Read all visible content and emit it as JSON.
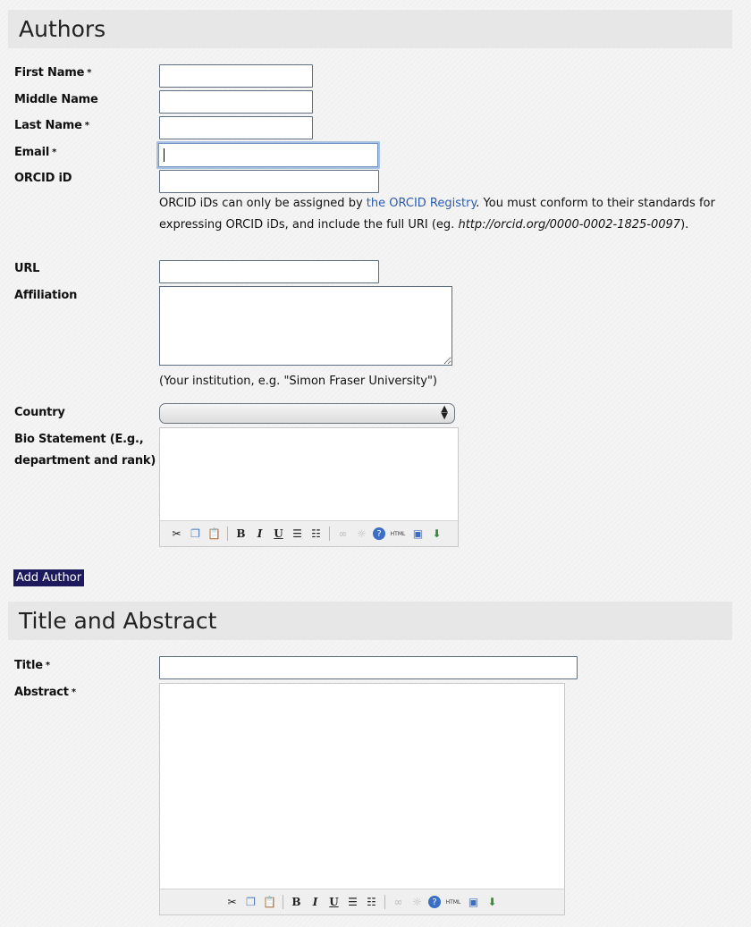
{
  "authors_section": {
    "title": "Authors",
    "first_name_label": "First Name",
    "middle_name_label": "Middle Name",
    "last_name_label": "Last Name",
    "email_label": "Email",
    "orcid_label": "ORCID iD",
    "orcid_note_1": "ORCID iDs can only be assigned by ",
    "orcid_link": "the ORCID Registry",
    "orcid_note_2": ". You must conform to their standards for expressing ORCID iDs, and include the full URI (eg. ",
    "orcid_example": "http://orcid.org/0000-0002-1825-0097",
    "orcid_note_3": ").",
    "url_label": "URL",
    "affiliation_label": "Affiliation",
    "affiliation_hint": "(Your institution, e.g. \"Simon Fraser University\")",
    "country_label": "Country",
    "country_value": "",
    "bio_label": "Bio Statement (E.g., department and rank)",
    "add_author_button": "Add Author",
    "required_mark": "*"
  },
  "title_section": {
    "title": "Title and Abstract",
    "title_label": "Title",
    "abstract_label": "Abstract"
  },
  "toolbar_icons": [
    "cut-icon",
    "copy-icon",
    "paste-icon",
    "bold-icon",
    "italic-icon",
    "underline-icon",
    "bullet-list-icon",
    "numbered-list-icon",
    "link-icon",
    "unlink-icon",
    "help-icon",
    "html-icon",
    "fullscreen-icon",
    "image-upload-icon"
  ],
  "colors": {
    "link": "#2a5db0",
    "button_bg": "#1c1a5c",
    "header_bg": "#e7e7e7"
  }
}
